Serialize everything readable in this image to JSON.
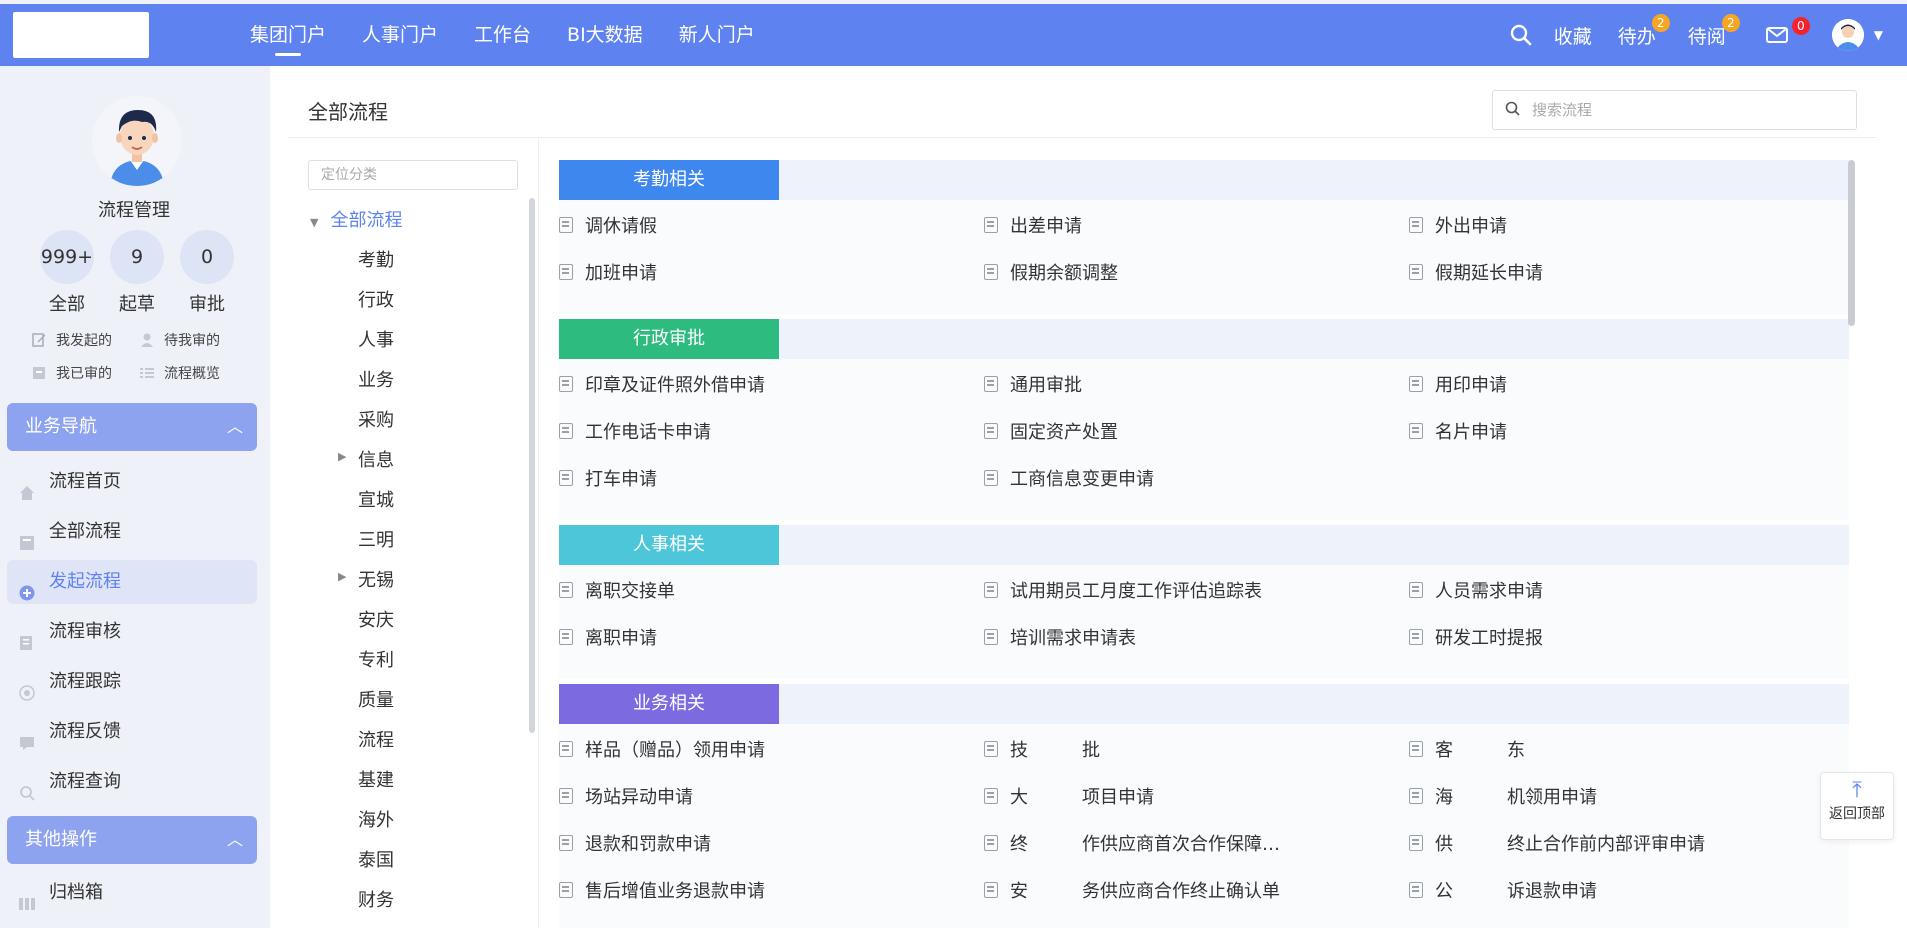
{
  "topnav": {
    "items": [
      "集团门户",
      "人事门户",
      "工作台",
      "BI大数据",
      "新人门户"
    ],
    "active_index": 0,
    "favorites_label": "收藏",
    "todo_label": "待办",
    "todo_count": "2",
    "toread_label": "待阅",
    "toread_count": "2",
    "mail_count": "0"
  },
  "profile": {
    "name": "流程管理",
    "stats": [
      {
        "value": "999+",
        "label": "全部"
      },
      {
        "value": "9",
        "label": "起草"
      },
      {
        "value": "0",
        "label": "审批"
      }
    ],
    "quick_links": [
      "我发起的",
      "待我审的",
      "我已审的",
      "流程概览"
    ]
  },
  "sidebar": {
    "section1": "业务导航",
    "items": [
      "流程首页",
      "全部流程",
      "发起流程",
      "流程审核",
      "流程跟踪",
      "流程反馈",
      "流程查询"
    ],
    "active_index": 2,
    "section2": "其他操作",
    "items2": [
      "归档箱"
    ]
  },
  "main": {
    "title": "全部流程",
    "search_placeholder": "搜索流程",
    "tree_placeholder": "定位分类",
    "tree_root": "全部流程",
    "tree_items": [
      "考勤",
      "行政",
      "人事",
      "业务",
      "采购",
      "信息",
      "宣城",
      "三明",
      "无锡",
      "安庆",
      "专利",
      "质量",
      "流程",
      "基建",
      "海外",
      "泰国",
      "财务"
    ]
  },
  "categories": [
    {
      "name": "考勤相关",
      "color": "#3e87ef",
      "items": [
        "调休请假",
        "出差申请",
        "外出申请",
        "加班申请",
        "假期余额调整",
        "假期延长申请"
      ]
    },
    {
      "name": "行政审批",
      "color": "#2dbb7f",
      "items": [
        "印章及证件照外借申请",
        "通用审批",
        "用印申请",
        "工作电话卡申请",
        "固定资产处置",
        "名片申请",
        "打车申请",
        "工商信息变更申请"
      ]
    },
    {
      "name": "人事相关",
      "color": "#4cc6d8",
      "items": [
        "离职交接单",
        "试用期员工月度工作评估追踪表",
        "人员需求申请",
        "离职申请",
        "培训需求申请表",
        "研发工时提报"
      ]
    },
    {
      "name": "业务相关",
      "color": "#7c6be0",
      "items": [
        "样品（赠品）领用申请",
        "技　　　批",
        "客　　　东",
        "场站异动申请",
        "大　　　项目申请",
        "海　　　机领用申请",
        "退款和罚款申请",
        "终　　　作供应商首次合作保障…",
        "供　　　终止合作前内部评审申请",
        "售后增值业务退款申请",
        "安　　　务供应商合作终止确认单",
        "公　　　诉退款申请"
      ]
    }
  ],
  "back_to_top": "返回顶部"
}
